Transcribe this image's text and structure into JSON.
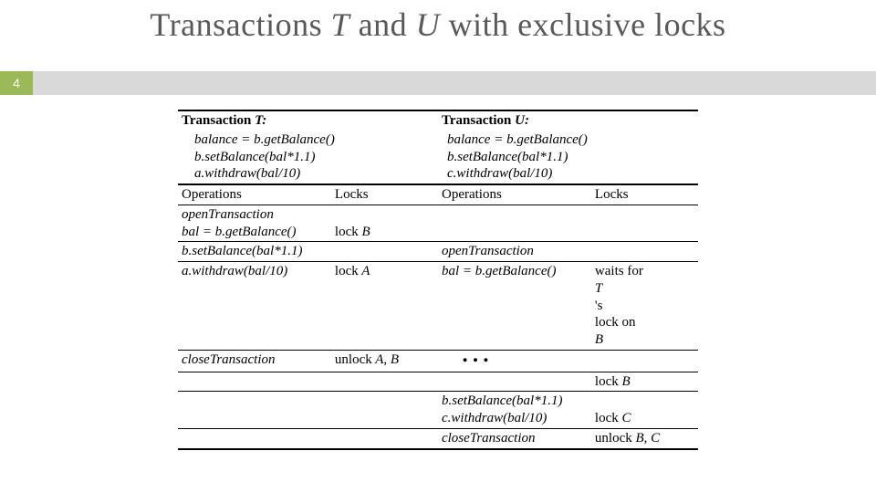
{
  "title": {
    "prefix": "Transactions ",
    "t": "T",
    "mid": " and ",
    "u": "U",
    "suffix": " with exclusive locks"
  },
  "page_number": "4",
  "header": {
    "txT_label": "Transaction",
    "txT_name": "T:",
    "txT_l1": "balance = b.getBalance()",
    "txT_l2": "b.setBalance(bal*1.1)",
    "txT_l3": "a.withdraw(bal/10)",
    "txU_label": "Transaction",
    "txU_name": "U:",
    "txU_l1": "balance = b.getBalance()",
    "txU_l2": "b.setBalance(bal*1.1)",
    "txU_l3": "c.withdraw(bal/10)",
    "ops": "Operations",
    "locks": "Locks"
  },
  "rows": {
    "t1a": "openTransaction",
    "t1b_op": "bal =  b.getBalance()",
    "t1b_lock": "lock B",
    "t2_op": "b.setBalance(bal*1.1)",
    "u2_op": "openTransaction",
    "t3_op": "a.withdraw(bal/10)",
    "t3_lock": "lock A",
    "u3_op": "bal =  b.getBalance()",
    "u3_lock_a_pre": "waits for",
    "u3_lock_a_var": "T",
    "u3_lock_a_post": "'s",
    "u3_lock_b_pre": "lock on",
    "u3_lock_b_var": "B",
    "t4_op": "closeTransaction",
    "t4_lock": "unlock A, B",
    "dots": "…",
    "u5_lock": "lock B",
    "u6a": "b.setBalance(bal*1.1)",
    "u6b_op": "c.withdraw(bal/10)",
    "u6b_lock": "lock C",
    "u7_op": "closeTransaction",
    "u7_lock": "unlock B, C"
  }
}
